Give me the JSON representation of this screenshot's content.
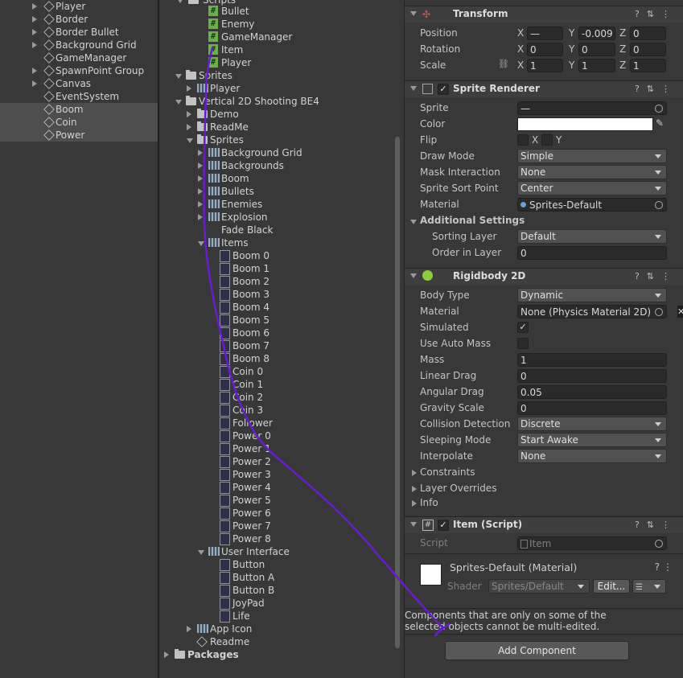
{
  "hierarchy": {
    "items": [
      {
        "label": "Player",
        "arrow": "right",
        "selected": false
      },
      {
        "label": "Border",
        "arrow": "right",
        "selected": false
      },
      {
        "label": "Border Bullet",
        "arrow": "right",
        "selected": false
      },
      {
        "label": "Background Grid",
        "arrow": "right",
        "selected": false
      },
      {
        "label": "GameManager",
        "arrow": "",
        "selected": false
      },
      {
        "label": "SpawnPoint Group",
        "arrow": "right",
        "selected": false
      },
      {
        "label": "Canvas",
        "arrow": "right",
        "selected": false
      },
      {
        "label": "EventSystem",
        "arrow": "",
        "selected": false
      },
      {
        "label": "Boom",
        "arrow": "",
        "selected": true
      },
      {
        "label": "Coin",
        "arrow": "",
        "selected": true
      },
      {
        "label": "Power",
        "arrow": "",
        "selected": true
      }
    ]
  },
  "project": {
    "top_partial": "Scripts",
    "items": [
      {
        "label": "Bullet",
        "icon": "script",
        "level": 3,
        "arrow": ""
      },
      {
        "label": "Enemy",
        "icon": "script",
        "level": 3,
        "arrow": ""
      },
      {
        "label": "GameManager",
        "icon": "script",
        "level": 3,
        "arrow": ""
      },
      {
        "label": "Item",
        "icon": "script",
        "level": 3,
        "arrow": ""
      },
      {
        "label": "Player",
        "icon": "script",
        "level": 3,
        "arrow": ""
      },
      {
        "label": "Sprites",
        "icon": "folder",
        "level": 1,
        "arrow": "down"
      },
      {
        "label": "Player",
        "icon": "sheet",
        "level": 2,
        "arrow": "right"
      },
      {
        "label": "Vertical 2D Shooting BE4",
        "icon": "folder",
        "level": 1,
        "arrow": "down"
      },
      {
        "label": "Demo",
        "icon": "folder",
        "level": 2,
        "arrow": "right"
      },
      {
        "label": "ReadMe",
        "icon": "folder",
        "level": 2,
        "arrow": "right"
      },
      {
        "label": "Sprites",
        "icon": "folder",
        "level": 2,
        "arrow": "down"
      },
      {
        "label": "Background Grid",
        "icon": "sheet",
        "level": 3,
        "arrow": "right"
      },
      {
        "label": "Backgrounds",
        "icon": "sheet",
        "level": 3,
        "arrow": "right"
      },
      {
        "label": "Boom",
        "icon": "sheet",
        "level": 3,
        "arrow": "right"
      },
      {
        "label": "Bullets",
        "icon": "sheet",
        "level": 3,
        "arrow": "right"
      },
      {
        "label": "Enemies",
        "icon": "sheet",
        "level": 3,
        "arrow": "right"
      },
      {
        "label": "Explosion",
        "icon": "sheet",
        "level": 3,
        "arrow": "right"
      },
      {
        "label": "Fade Black",
        "icon": "none",
        "level": 3,
        "arrow": ""
      },
      {
        "label": "Items",
        "icon": "sheet",
        "level": 3,
        "arrow": "down"
      },
      {
        "label": "Boom 0",
        "icon": "sprite",
        "level": 4,
        "arrow": ""
      },
      {
        "label": "Boom 1",
        "icon": "sprite",
        "level": 4,
        "arrow": ""
      },
      {
        "label": "Boom 2",
        "icon": "sprite",
        "level": 4,
        "arrow": ""
      },
      {
        "label": "Boom 3",
        "icon": "sprite",
        "level": 4,
        "arrow": ""
      },
      {
        "label": "Boom 4",
        "icon": "sprite",
        "level": 4,
        "arrow": ""
      },
      {
        "label": "Boom 5",
        "icon": "sprite",
        "level": 4,
        "arrow": ""
      },
      {
        "label": "Boom 6",
        "icon": "sprite",
        "level": 4,
        "arrow": ""
      },
      {
        "label": "Boom 7",
        "icon": "sprite",
        "level": 4,
        "arrow": ""
      },
      {
        "label": "Boom 8",
        "icon": "sprite",
        "level": 4,
        "arrow": ""
      },
      {
        "label": "Coin 0",
        "icon": "sprite",
        "level": 4,
        "arrow": ""
      },
      {
        "label": "Coin 1",
        "icon": "sprite",
        "level": 4,
        "arrow": ""
      },
      {
        "label": "Coin 2",
        "icon": "sprite",
        "level": 4,
        "arrow": ""
      },
      {
        "label": "Coin 3",
        "icon": "sprite",
        "level": 4,
        "arrow": ""
      },
      {
        "label": "Follower",
        "icon": "sprite",
        "level": 4,
        "arrow": ""
      },
      {
        "label": "Power 0",
        "icon": "sprite",
        "level": 4,
        "arrow": ""
      },
      {
        "label": "Power 1",
        "icon": "sprite",
        "level": 4,
        "arrow": ""
      },
      {
        "label": "Power 2",
        "icon": "sprite",
        "level": 4,
        "arrow": ""
      },
      {
        "label": "Power 3",
        "icon": "sprite",
        "level": 4,
        "arrow": ""
      },
      {
        "label": "Power 4",
        "icon": "sprite",
        "level": 4,
        "arrow": ""
      },
      {
        "label": "Power 5",
        "icon": "sprite",
        "level": 4,
        "arrow": ""
      },
      {
        "label": "Power 6",
        "icon": "sprite",
        "level": 4,
        "arrow": ""
      },
      {
        "label": "Power 7",
        "icon": "sprite",
        "level": 4,
        "arrow": ""
      },
      {
        "label": "Power 8",
        "icon": "sprite",
        "level": 4,
        "arrow": ""
      },
      {
        "label": "User Interface",
        "icon": "sheet",
        "level": 3,
        "arrow": "down"
      },
      {
        "label": "Button",
        "icon": "sprite",
        "level": 4,
        "arrow": ""
      },
      {
        "label": "Button A",
        "icon": "sprite",
        "level": 4,
        "arrow": ""
      },
      {
        "label": "Button B",
        "icon": "sprite",
        "level": 4,
        "arrow": ""
      },
      {
        "label": "JoyPad",
        "icon": "sprite",
        "level": 4,
        "arrow": ""
      },
      {
        "label": "Life",
        "icon": "sprite",
        "level": 4,
        "arrow": ""
      },
      {
        "label": "App Icon",
        "icon": "sheet",
        "level": 2,
        "arrow": "right"
      },
      {
        "label": "Readme",
        "icon": "readme",
        "level": 2,
        "arrow": ""
      },
      {
        "label": "Packages",
        "icon": "folder",
        "level": 0,
        "arrow": "right"
      }
    ]
  },
  "inspector": {
    "transform": {
      "title": "Transform",
      "position_label": "Position",
      "position": {
        "x": "—",
        "y": "-0.009",
        "z": "0"
      },
      "rotation_label": "Rotation",
      "rotation": {
        "x": "0",
        "y": "0",
        "z": "0"
      },
      "scale_label": "Scale",
      "scale": {
        "x": "1",
        "y": "1",
        "z": "1"
      }
    },
    "sprite_renderer": {
      "title": "Sprite Renderer",
      "sprite_label": "Sprite",
      "sprite_value": "—",
      "color_label": "Color",
      "flip_label": "Flip",
      "flip_x": "X",
      "flip_y": "Y",
      "draw_mode_label": "Draw Mode",
      "draw_mode": "Simple",
      "mask_label": "Mask Interaction",
      "mask": "None",
      "sort_point_label": "Sprite Sort Point",
      "sort_point": "Center",
      "material_label": "Material",
      "material": "Sprites-Default",
      "additional_label": "Additional Settings",
      "sorting_layer_label": "Sorting Layer",
      "sorting_layer": "Default",
      "order_label": "Order in Layer",
      "order": "0"
    },
    "rigidbody": {
      "title": "Rigidbody 2D",
      "body_type_label": "Body Type",
      "body_type": "Dynamic",
      "material_label": "Material",
      "material": "None (Physics Material 2D)",
      "simulated_label": "Simulated",
      "auto_mass_label": "Use Auto Mass",
      "mass_label": "Mass",
      "mass": "1",
      "linear_drag_label": "Linear Drag",
      "linear_drag": "0",
      "angular_drag_label": "Angular Drag",
      "angular_drag": "0.05",
      "gravity_label": "Gravity Scale",
      "gravity": "0",
      "collision_label": "Collision Detection",
      "collision": "Discrete",
      "sleeping_label": "Sleeping Mode",
      "sleeping": "Start Awake",
      "interpolate_label": "Interpolate",
      "interpolate": "None",
      "constraints_label": "Constraints",
      "layer_overrides_label": "Layer Overrides",
      "info_label": "Info"
    },
    "item_script": {
      "title": "Item (Script)",
      "script_label": "Script",
      "script_value": "Item"
    },
    "material_block": {
      "title": "Sprites-Default (Material)",
      "shader_label": "Shader",
      "shader_value": "Sprites/Default",
      "edit_label": "Edit..."
    },
    "notice": "Components that are only on some of the selected objects cannot be multi-edited.",
    "add_component": "Add Component"
  },
  "colors": {
    "annotation": "#6a1bd1",
    "selection": "#4d4d4d",
    "panel": "#383838"
  }
}
